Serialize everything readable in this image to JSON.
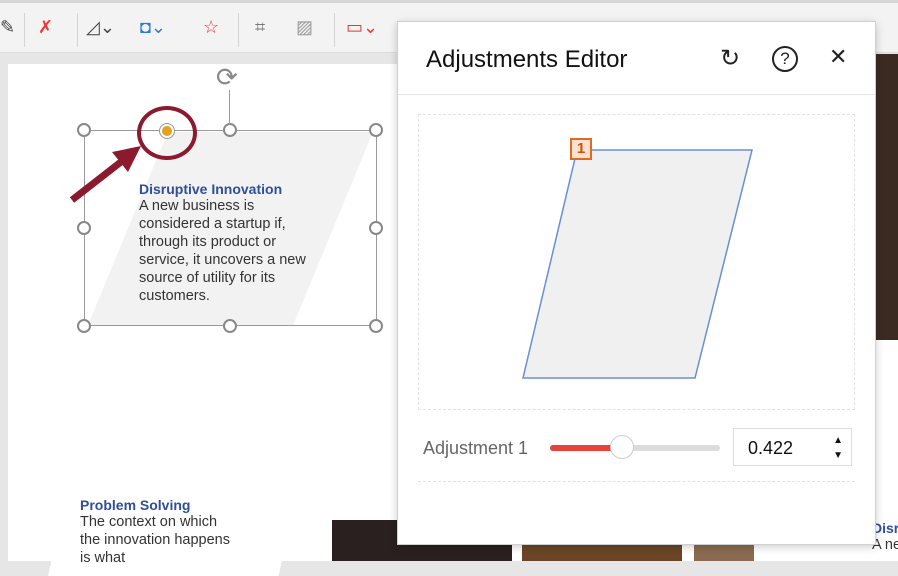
{
  "toolbar": {
    "icons": [
      "pen-icon",
      "eyedropper-icon",
      "rotate-shape-icon",
      "shape-fill-icon",
      "star-icon",
      "crop-icon",
      "picture-icon",
      "slideshow-icon"
    ]
  },
  "slide": {
    "selected": {
      "title": "Disruptive Innovation",
      "body": "A new business is considered a startup if, through its product or service, it uncovers a new source of utility for its customers."
    },
    "second": {
      "title": "Problem Solving",
      "body": "The context on which the innovation happens is what"
    },
    "third": {
      "title": "Disru",
      "body": "A ne"
    }
  },
  "panel": {
    "title": "Adjustments Editor",
    "handle_label": "1",
    "adjustment_label": "Adjustment 1",
    "value": "0.422",
    "value_fraction": 0.422
  },
  "colors": {
    "accent": "#e9423a",
    "highlight": "#8b1a2e",
    "handle": "#e8a020"
  }
}
